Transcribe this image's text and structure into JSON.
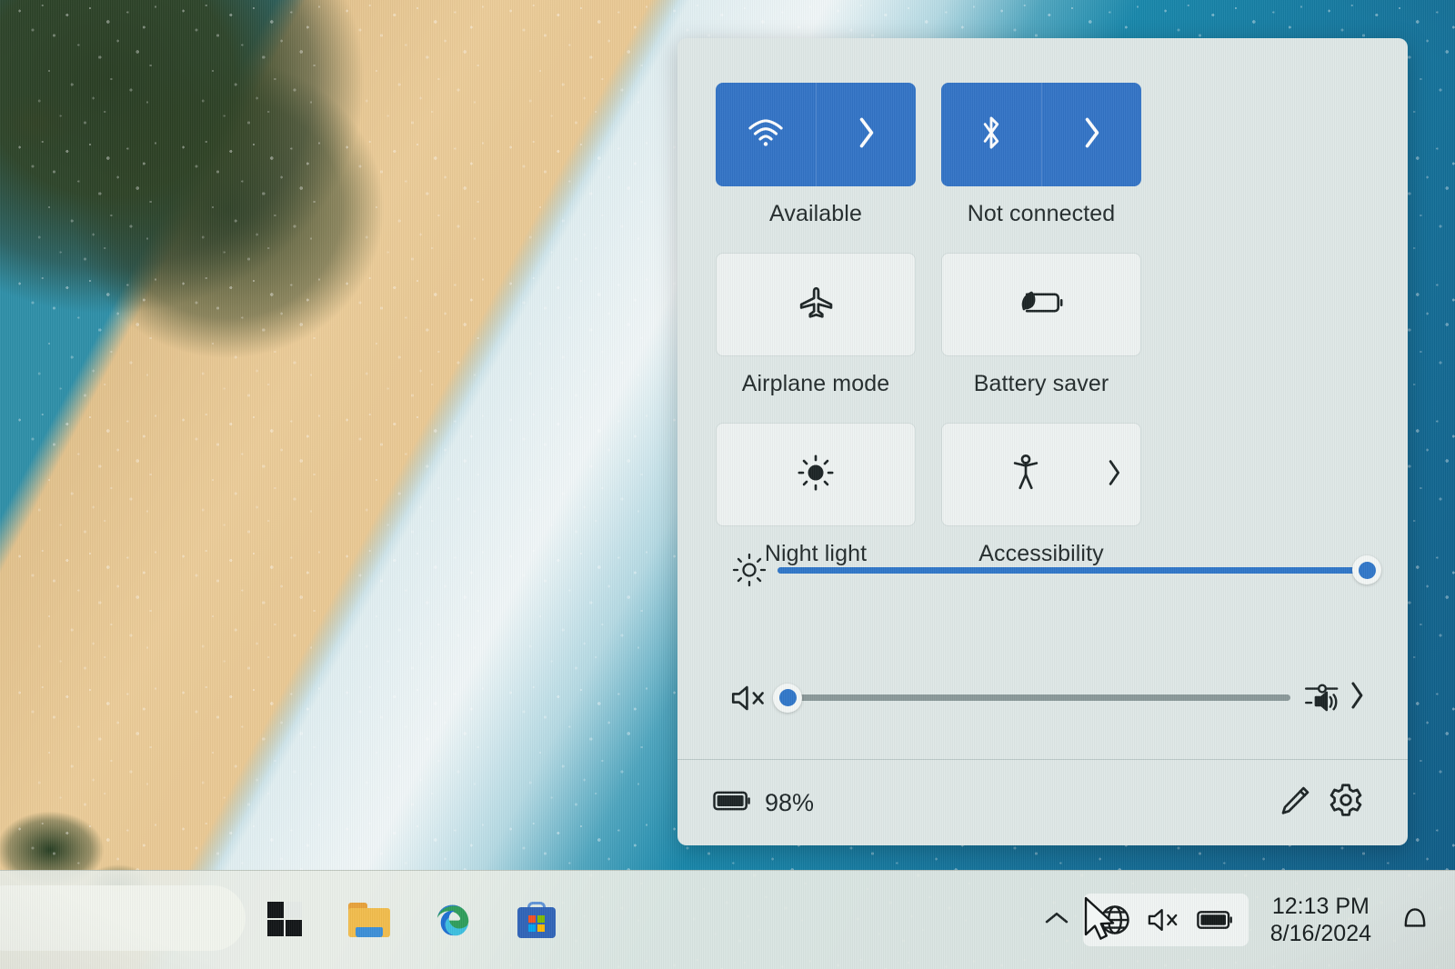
{
  "quick_settings": {
    "tiles": [
      {
        "id": "wifi",
        "label": "Available",
        "icon": "wifi-icon",
        "state": "on",
        "has_chevron": true,
        "chevron_split": true
      },
      {
        "id": "bluetooth",
        "label": "Not connected",
        "icon": "bluetooth-icon",
        "state": "on",
        "has_chevron": true,
        "chevron_split": true
      },
      {
        "id": "airplane",
        "label": "Airplane mode",
        "icon": "airplane-icon",
        "state": "off",
        "has_chevron": false,
        "chevron_split": false
      },
      {
        "id": "battery-saver",
        "label": "Battery saver",
        "icon": "battery-leaf-icon",
        "state": "off",
        "has_chevron": false,
        "chevron_split": false
      },
      {
        "id": "night-light",
        "label": "Night light",
        "icon": "brightness-icon",
        "state": "off",
        "has_chevron": false,
        "chevron_split": false
      },
      {
        "id": "accessibility",
        "label": "Accessibility",
        "icon": "accessibility-icon",
        "state": "off",
        "has_chevron": true,
        "chevron_split": false
      }
    ],
    "brightness_slider": {
      "icon": "brightness-icon",
      "value": 100,
      "min": 0,
      "max": 100
    },
    "volume_slider": {
      "icon": "speaker-mute-icon",
      "value": 2,
      "min": 0,
      "max": 100,
      "end_icon": "audio-output-picker-icon"
    },
    "footer": {
      "battery_icon": "battery-full-icon",
      "battery_percent": "98%",
      "edit_label": "edit-quick-settings",
      "settings_label": "open-settings"
    },
    "colors": {
      "panel_background": "#dfe8e7",
      "tile_active": "#3273c6",
      "tile_inactive": "#eef3f2",
      "accent": "#2f76c9",
      "track_inactive": "#8a9899",
      "text": "#232b2c"
    }
  },
  "taskbar": {
    "apps": [
      {
        "id": "start",
        "name": "start-button",
        "icon": "windows-logo-icon"
      },
      {
        "id": "explorer",
        "name": "file-explorer-button",
        "icon": "folder-icon"
      },
      {
        "id": "edge",
        "name": "microsoft-edge-button",
        "icon": "edge-icon"
      },
      {
        "id": "store",
        "name": "microsoft-store-button",
        "icon": "store-icon"
      }
    ],
    "tray": {
      "overflow_icon": "chevron-up-icon",
      "network_icon": "globe-no-internet-icon",
      "volume_icon": "speaker-mute-icon",
      "battery_icon": "battery-full-icon",
      "time": "12:13 PM",
      "date": "8/16/2024",
      "notification_icon": "bell-icon"
    }
  },
  "desktop": {
    "wallpaper_description": "aerial beach coastline with turquoise water and sand"
  }
}
